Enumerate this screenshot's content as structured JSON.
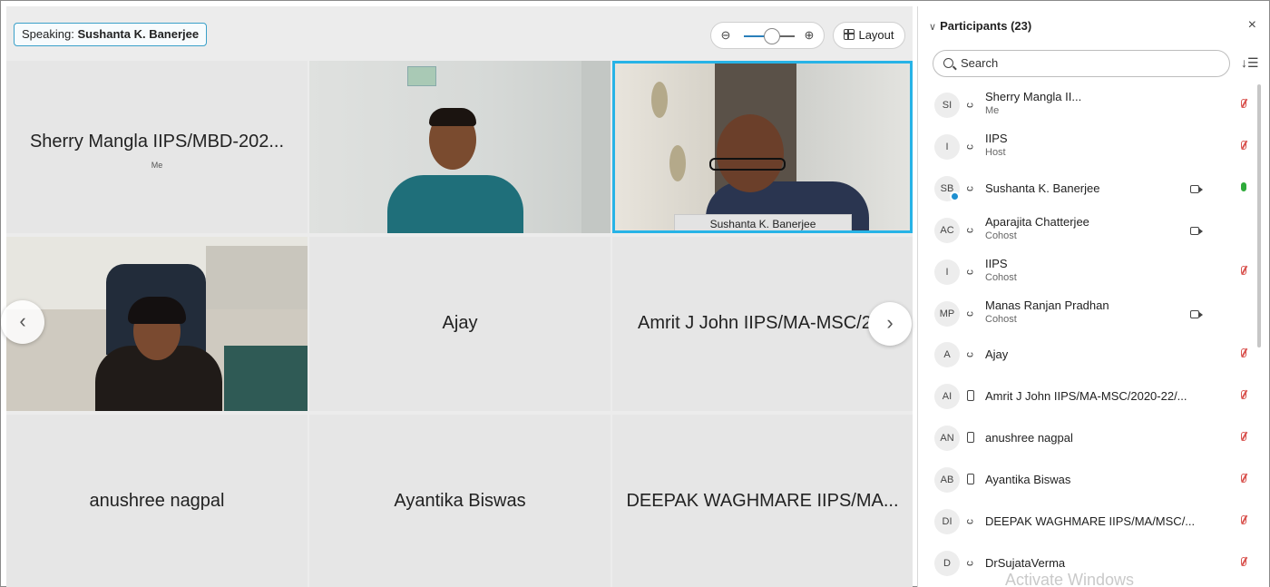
{
  "toolbar": {
    "speaking_prefix": "Speaking:",
    "speaking_name": "Sushanta K. Banerjee",
    "zoom_out_glyph": "⊖",
    "zoom_in_glyph": "⊕",
    "layout_label": "Layout"
  },
  "grid": {
    "tiles": [
      {
        "name": "Sherry Mangla IIPS/MBD-202...",
        "sub": "Me"
      },
      {
        "name": "Ajay"
      },
      {
        "name": "Amrit J John IIPS/MA-MSC/2("
      },
      {
        "name": "anushree nagpal"
      },
      {
        "name": "Ayantika Biswas"
      },
      {
        "name": "DEEPAK WAGHMARE IIPS/MA..."
      }
    ],
    "video_tag": "Sushanta K. Banerjee",
    "prev_glyph": "‹",
    "next_glyph": "›"
  },
  "panel": {
    "title": "Participants (23)",
    "close_glyph": "×",
    "search_placeholder": "Search",
    "sort_glyph": "↓☰",
    "participants": [
      {
        "initials": "SI",
        "name": "Sherry Mangla II...",
        "role": "Me",
        "device": "headset",
        "camera": false,
        "mic": "muted"
      },
      {
        "initials": "I",
        "name": "IIPS",
        "role": "Host",
        "device": "headset",
        "camera": false,
        "mic": "muted"
      },
      {
        "initials": "SB",
        "name": "Sushanta K. Banerjee",
        "role": "",
        "device": "headset",
        "camera": true,
        "mic": "live"
      },
      {
        "initials": "AC",
        "name": "Aparajita Chatterjee",
        "role": "Cohost",
        "device": "headset",
        "camera": true,
        "mic": "none"
      },
      {
        "initials": "I",
        "name": "IIPS",
        "role": "Cohost",
        "device": "headset",
        "camera": false,
        "mic": "muted"
      },
      {
        "initials": "MP",
        "name": "Manas Ranjan Pradhan",
        "role": "Cohost",
        "device": "headset",
        "camera": true,
        "mic": "none"
      },
      {
        "initials": "A",
        "name": "Ajay",
        "role": "",
        "device": "headset",
        "camera": false,
        "mic": "muted"
      },
      {
        "initials": "AI",
        "name": "Amrit J John IIPS/MA-MSC/2020-22/...",
        "role": "",
        "device": "phone",
        "camera": false,
        "mic": "muted"
      },
      {
        "initials": "AN",
        "name": "anushree nagpal",
        "role": "",
        "device": "phone",
        "camera": false,
        "mic": "muted"
      },
      {
        "initials": "AB",
        "name": "Ayantika Biswas",
        "role": "",
        "device": "phone",
        "camera": false,
        "mic": "muted"
      },
      {
        "initials": "DI",
        "name": "DEEPAK WAGHMARE IIPS/MA/MSC/...",
        "role": "",
        "device": "headset",
        "camera": false,
        "mic": "muted"
      },
      {
        "initials": "D",
        "name": "DrSujataVerma",
        "role": "",
        "device": "headset",
        "camera": false,
        "mic": "muted"
      }
    ]
  },
  "watermark": "Activate Windows"
}
